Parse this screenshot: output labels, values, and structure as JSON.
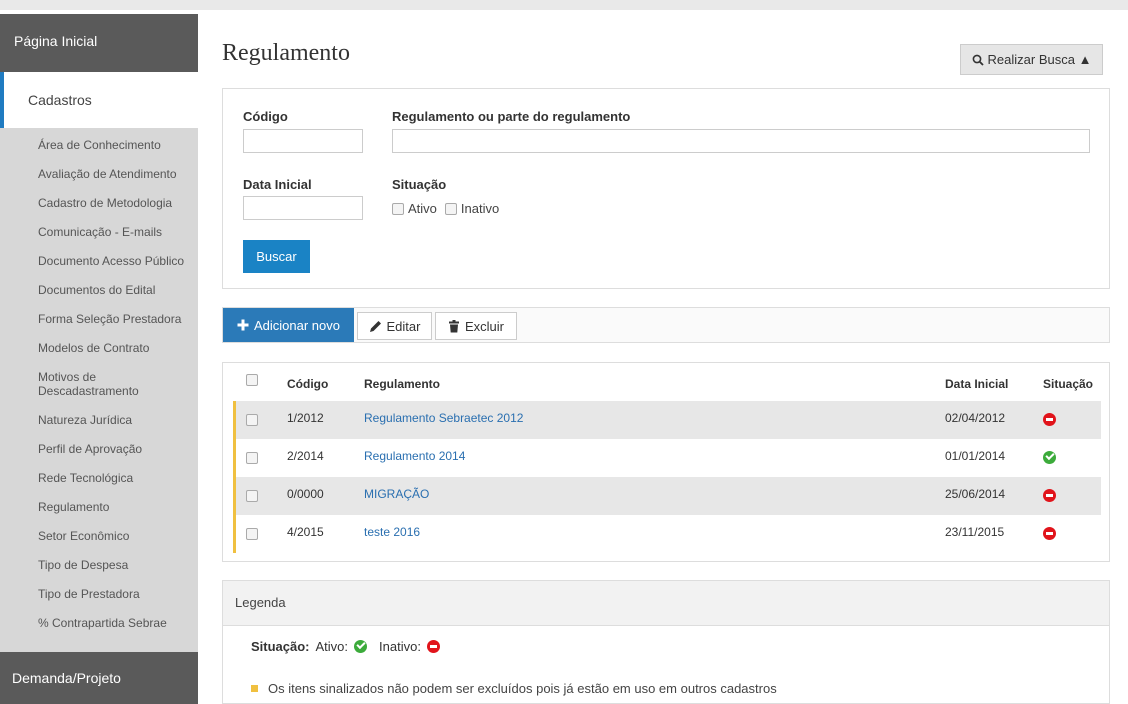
{
  "sidebar": {
    "home": "Página Inicial",
    "active_section": "Cadastros",
    "items": [
      "Área de Conhecimento",
      "Avaliação de Atendimento",
      "Cadastro de Metodologia",
      "Comunicação - E-mails",
      "Documento Acesso Público",
      "Documentos do Edital",
      "Forma Seleção Prestadora",
      "Modelos de Contrato",
      "Motivos de Descadastramento",
      "Natureza Jurídica",
      "Perfil de Aprovação",
      "Rede Tecnológica",
      "Regulamento",
      "Setor Econômico",
      "Tipo de Despesa",
      "Tipo de Prestadora",
      "% Contrapartida Sebrae"
    ],
    "footer": "Demanda/Projeto"
  },
  "page": {
    "title": "Regulamento",
    "search_toggle": "Realizar Busca ▲"
  },
  "filter": {
    "codigo_label": "Código",
    "regulamento_label": "Regulamento ou parte do regulamento",
    "data_label": "Data Inicial",
    "situacao_label": "Situação",
    "ativo_label": "Ativo",
    "inativo_label": "Inativo",
    "buscar": "Buscar"
  },
  "toolbar": {
    "add": "Adicionar novo",
    "edit": "Editar",
    "delete": "Excluir"
  },
  "table": {
    "headers": {
      "codigo": "Código",
      "regulamento": "Regulamento",
      "data": "Data Inicial",
      "situacao": "Situação"
    },
    "rows": [
      {
        "codigo": "1/2012",
        "regulamento": "Regulamento Sebraetec 2012",
        "data": "02/04/2012",
        "status": "inativo"
      },
      {
        "codigo": "2/2014",
        "regulamento": "Regulamento 2014",
        "data": "01/01/2014",
        "status": "ativo"
      },
      {
        "codigo": "0/0000",
        "regulamento": "MIGRAÇÃO",
        "data": "25/06/2014",
        "status": "inativo"
      },
      {
        "codigo": "4/2015",
        "regulamento": "teste 2016",
        "data": "23/11/2015",
        "status": "inativo"
      }
    ]
  },
  "legend": {
    "title": "Legenda",
    "situacao": "Situação:",
    "ativo": "Ativo:",
    "inativo": "Inativo:",
    "note": "Os itens sinalizados não podem ser excluídos pois já estão em uso em outros cadastros"
  },
  "colors": {
    "accent": "#1a83c5",
    "ativo": "#3cab3b",
    "inativo": "#e1141b",
    "marker": "#f0c040"
  }
}
